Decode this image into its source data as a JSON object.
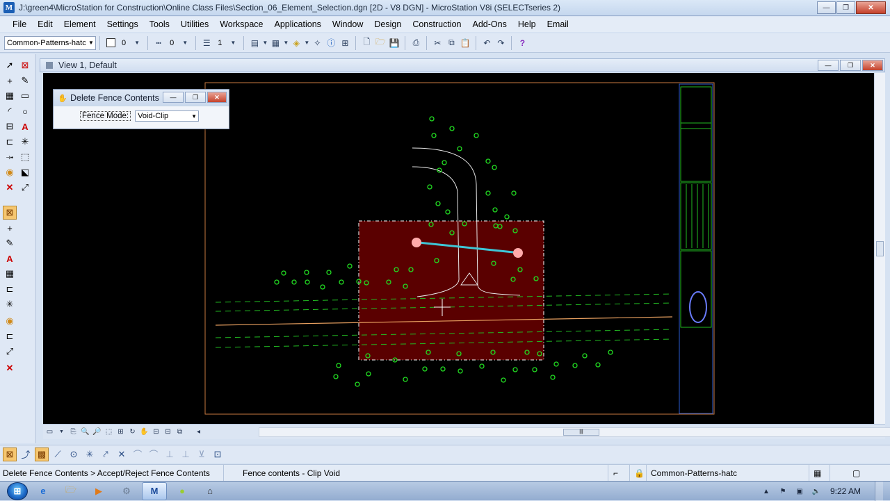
{
  "window": {
    "title": "J:\\green4\\MicroStation for Construction\\Online Class Files\\Section_06_Element_Selection.dgn [2D - V8 DGN] - MicroStation V8i (SELECTseries 2)",
    "app_icon_letter": "M"
  },
  "menu": [
    "File",
    "Edit",
    "Element",
    "Settings",
    "Tools",
    "Utilities",
    "Workspace",
    "Applications",
    "Window",
    "Design",
    "Construction",
    "Add-Ons",
    "Help",
    "Email"
  ],
  "toolbar": {
    "level_combo": "Common-Patterns-hatc",
    "color_value": "0",
    "style_value": "0",
    "weight_value": "1"
  },
  "view": {
    "title": "View 1, Default"
  },
  "dialog": {
    "title": "Delete Fence Contents",
    "fence_mode_label": "Fence Mode:",
    "fence_mode_value": "Void-Clip"
  },
  "status": {
    "prompt": "Delete Fence Contents > Accept/Reject Fence Contents",
    "message": "Fence contents - Clip Void",
    "active_level": "Common-Patterns-hatc"
  },
  "taskbar": {
    "clock": "9:22 AM"
  },
  "colors": {
    "canvas_bg": "#000000",
    "shrub_green": "#22dd22",
    "fence_fill": "#5a0000",
    "drawing_border": "#d4864a"
  }
}
